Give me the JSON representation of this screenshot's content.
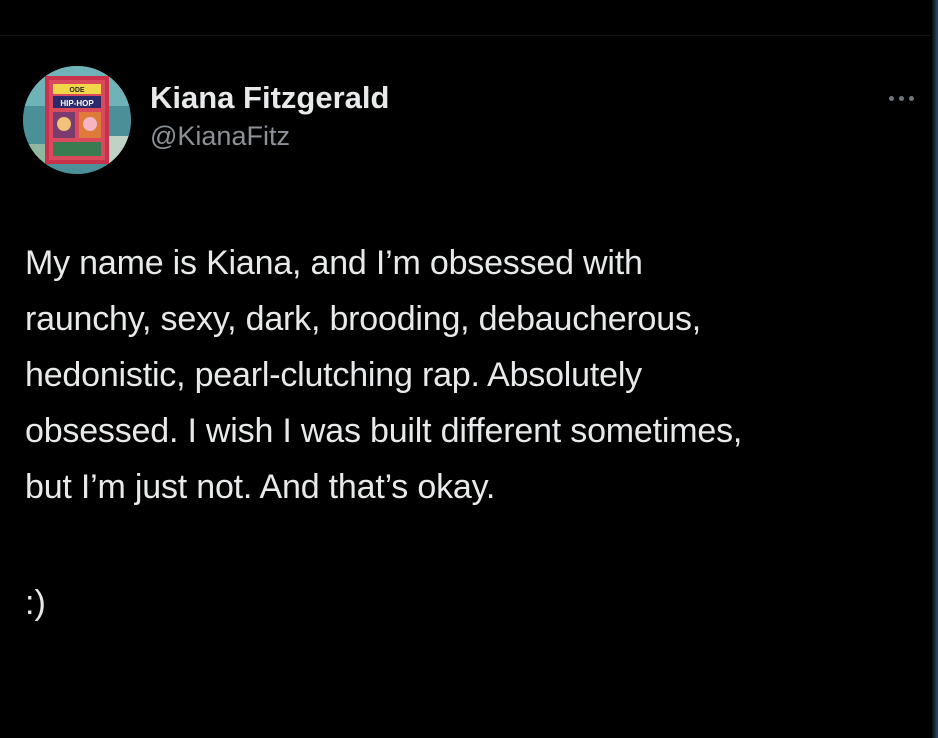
{
  "tweet": {
    "author": {
      "display_name": "Kiana Fitzgerald",
      "handle": "@KianaFitz",
      "avatar_icon": "album-cover-avatar",
      "avatar_text": [
        "ODE",
        "HIP-HOP"
      ]
    },
    "more_icon": "more-horizontal-icon",
    "text_lines": [
      "My name is Kiana, and I’m obsessed with",
      "raunchy, sexy, dark, brooding, debaucherous,",
      "hedonistic, pearl-clutching rap. Absolutely",
      "obsessed. I wish I was built different sometimes,",
      "but I’m just not. And that’s okay."
    ],
    "emoticon": ":)"
  },
  "colors": {
    "background": "#000000",
    "primary_text": "#e7e9ea",
    "secondary_text": "#8b9197",
    "more_icon": "#6e767d"
  }
}
